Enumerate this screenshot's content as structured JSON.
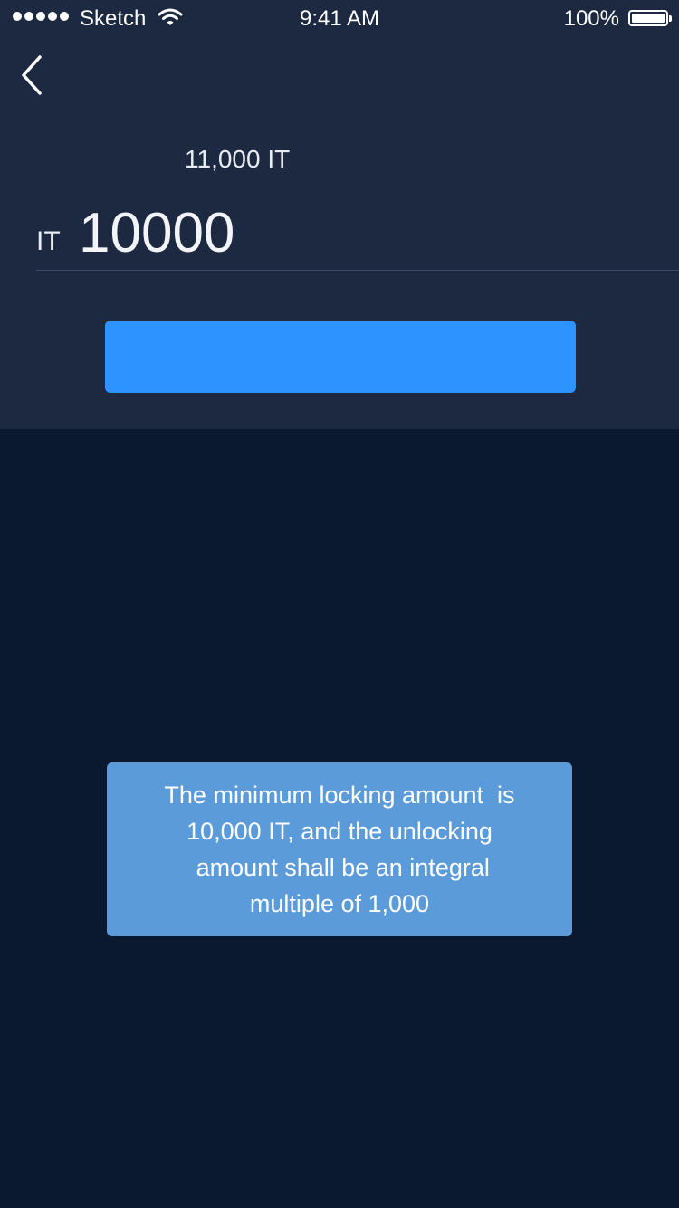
{
  "status_bar": {
    "carrier": "Sketch",
    "time": "9:41 AM",
    "battery": "100%",
    "icons": [
      "signal-dots-icon",
      "wifi-icon",
      "battery-icon"
    ]
  },
  "nav": {
    "back_icon": "chevron-left-icon"
  },
  "balance": {
    "text": "11,000 IT"
  },
  "amount": {
    "unit": "IT",
    "value": "10000"
  },
  "confirm_button": {
    "label": "",
    "color": "#2d93ff"
  },
  "toast": {
    "message": "The minimum locking amount  is\n10,000 IT, and the unlocking\n amount shall be an integral\nmultiple of 1,000",
    "color": "#5b9bd9"
  },
  "colors": {
    "header_bg": "#1c2940",
    "page_bg": "#0a1930"
  }
}
